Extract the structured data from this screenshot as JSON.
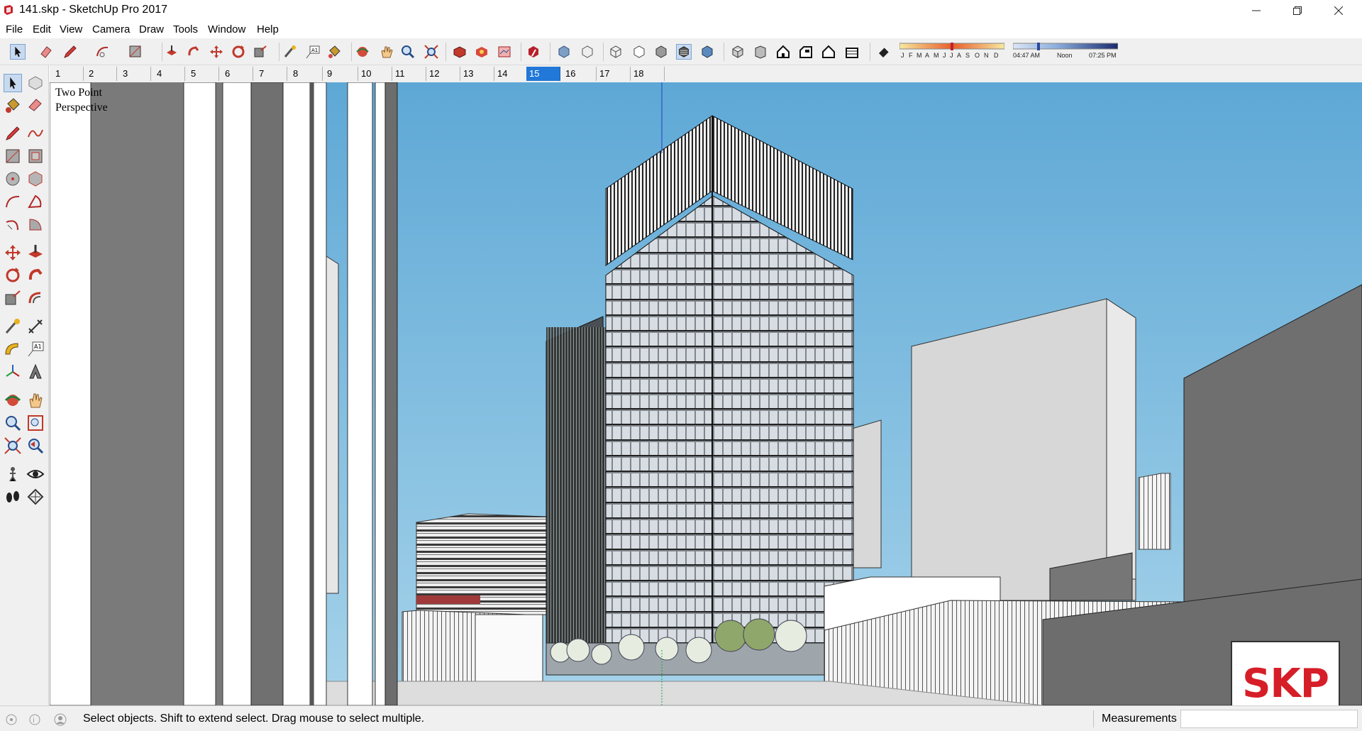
{
  "window": {
    "title": "141.skp - SketchUp Pro 2017",
    "minimize_icon": "minimize-icon",
    "maximize_icon": "restore-icon",
    "close_icon": "close-icon"
  },
  "menu": [
    "File",
    "Edit",
    "View",
    "Camera",
    "Draw",
    "Tools",
    "Window",
    "Help"
  ],
  "toolbar": {
    "icons": [
      "select",
      "eraser",
      "pencil",
      "arc",
      "rectangle",
      "push-pull",
      "follow-me",
      "move",
      "rotate",
      "scale",
      "tape-measure",
      "text",
      "paint-bucket",
      "orbit",
      "pan",
      "zoom",
      "zoom-extents",
      "3d-warehouse",
      "extension-warehouse",
      "layout",
      "extension-manager",
      "xray",
      "back-edges",
      "wireframe",
      "hidden-line",
      "shaded",
      "shaded-with-textures",
      "monochrome",
      "iso",
      "top",
      "front",
      "right",
      "back",
      "left",
      "shadows"
    ],
    "shadow_months": [
      "J",
      "F",
      "M",
      "A",
      "M",
      "J",
      "J",
      "A",
      "S",
      "O",
      "N",
      "D"
    ],
    "shadow_time_start": "04:47 AM",
    "shadow_time_mid": "Noon",
    "shadow_time_end": "07:25 PM"
  },
  "scene_tabs": [
    "1",
    "2",
    "3",
    "4",
    "5",
    "6",
    "7",
    "8",
    "9",
    "10",
    "11",
    "12",
    "13",
    "14",
    "15",
    "16",
    "17",
    "18"
  ],
  "active_scene": "15",
  "viewport": {
    "camera_label": "Two Point\nPerspective",
    "sky_top": "#5ea8d6",
    "sky_bottom": "#a6d3ea"
  },
  "watermark": "SKP",
  "status": {
    "message": "Select objects. Shift to extend select. Drag mouse to select multiple.",
    "measurements_label": "Measurements",
    "measurements_value": ""
  }
}
